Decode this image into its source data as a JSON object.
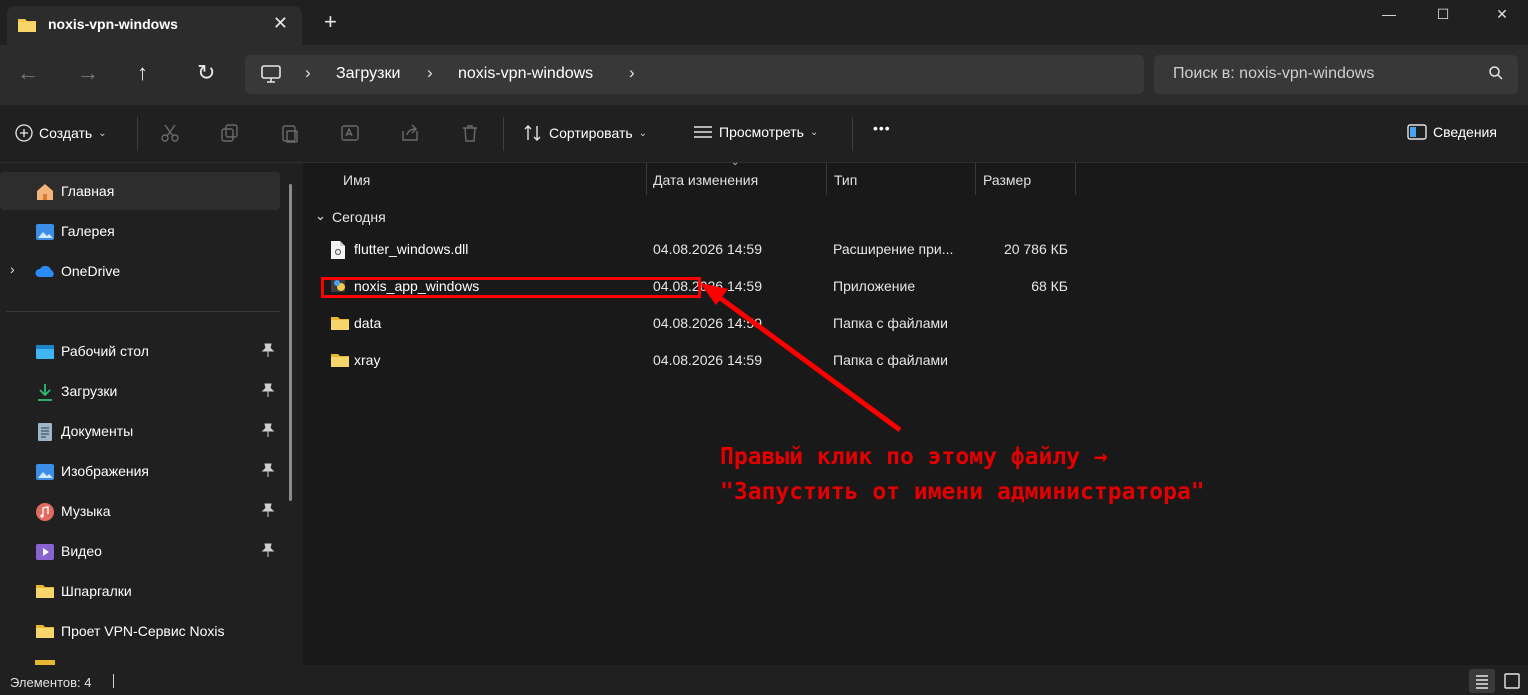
{
  "window": {
    "tab_title": "noxis-vpn-windows",
    "new_tab": "+",
    "tab_close": "✕",
    "minimize": "—",
    "maximize": "☐",
    "close": "✕"
  },
  "nav": {
    "back": "←",
    "forward": "→",
    "up": "↑",
    "refresh": "↻",
    "breadcrumbs": [
      "Загрузки",
      "noxis-vpn-windows"
    ],
    "separator": "›",
    "search_placeholder": "Поиск в: noxis-vpn-windows"
  },
  "toolbar": {
    "create": "Создать",
    "sort": "Сортировать",
    "view": "Просмотреть",
    "more": "•••",
    "details": "Сведения"
  },
  "sidebar": {
    "top": [
      {
        "label": "Главная",
        "icon": "home-icon"
      },
      {
        "label": "Галерея",
        "icon": "gallery-icon"
      },
      {
        "label": "OneDrive",
        "icon": "onedrive-icon"
      }
    ],
    "pinned": [
      {
        "label": "Рабочий стол",
        "icon": "desktop-icon",
        "pin": "📌"
      },
      {
        "label": "Загрузки",
        "icon": "download-icon",
        "pin": "📌"
      },
      {
        "label": "Документы",
        "icon": "documents-icon",
        "pin": "📌"
      },
      {
        "label": "Изображения",
        "icon": "pictures-icon",
        "pin": "📌"
      },
      {
        "label": "Музыка",
        "icon": "music-icon",
        "pin": "📌"
      },
      {
        "label": "Видео",
        "icon": "video-icon",
        "pin": "📌"
      },
      {
        "label": "Шпаргалки",
        "icon": "folder-icon"
      },
      {
        "label": "Проет VPN-Сервис Noxis",
        "icon": "folder-icon"
      }
    ]
  },
  "columns": {
    "name": "Имя",
    "date": "Дата изменения",
    "type": "Тип",
    "size": "Размер"
  },
  "group": {
    "label": "Сегодня"
  },
  "files": [
    {
      "name": "flutter_windows.dll",
      "date": "04.08.2026 14:59",
      "type": "Расширение при...",
      "size": "20 786 КБ",
      "icon": "dll-file-icon"
    },
    {
      "name": "noxis_app_windows",
      "date": "04.08.2026 14:59",
      "type": "Приложение",
      "size": "68 КБ",
      "icon": "app-exe-icon"
    },
    {
      "name": "data",
      "date": "04.08.2026 14:59",
      "type": "Папка с файлами",
      "size": "",
      "icon": "folder-icon"
    },
    {
      "name": "xray",
      "date": "04.08.2026 14:59",
      "type": "Папка с файлами",
      "size": "",
      "icon": "folder-icon"
    }
  ],
  "annotation": {
    "line1": "Правый клик по этому файлу →",
    "line2": "\"Запустить от имени администратора\"",
    "color": "#e40000"
  },
  "status": {
    "items_text": "Элементов: 4"
  },
  "colors": {
    "accent_folder": "#f2c94c",
    "highlight": "#ff0000"
  }
}
